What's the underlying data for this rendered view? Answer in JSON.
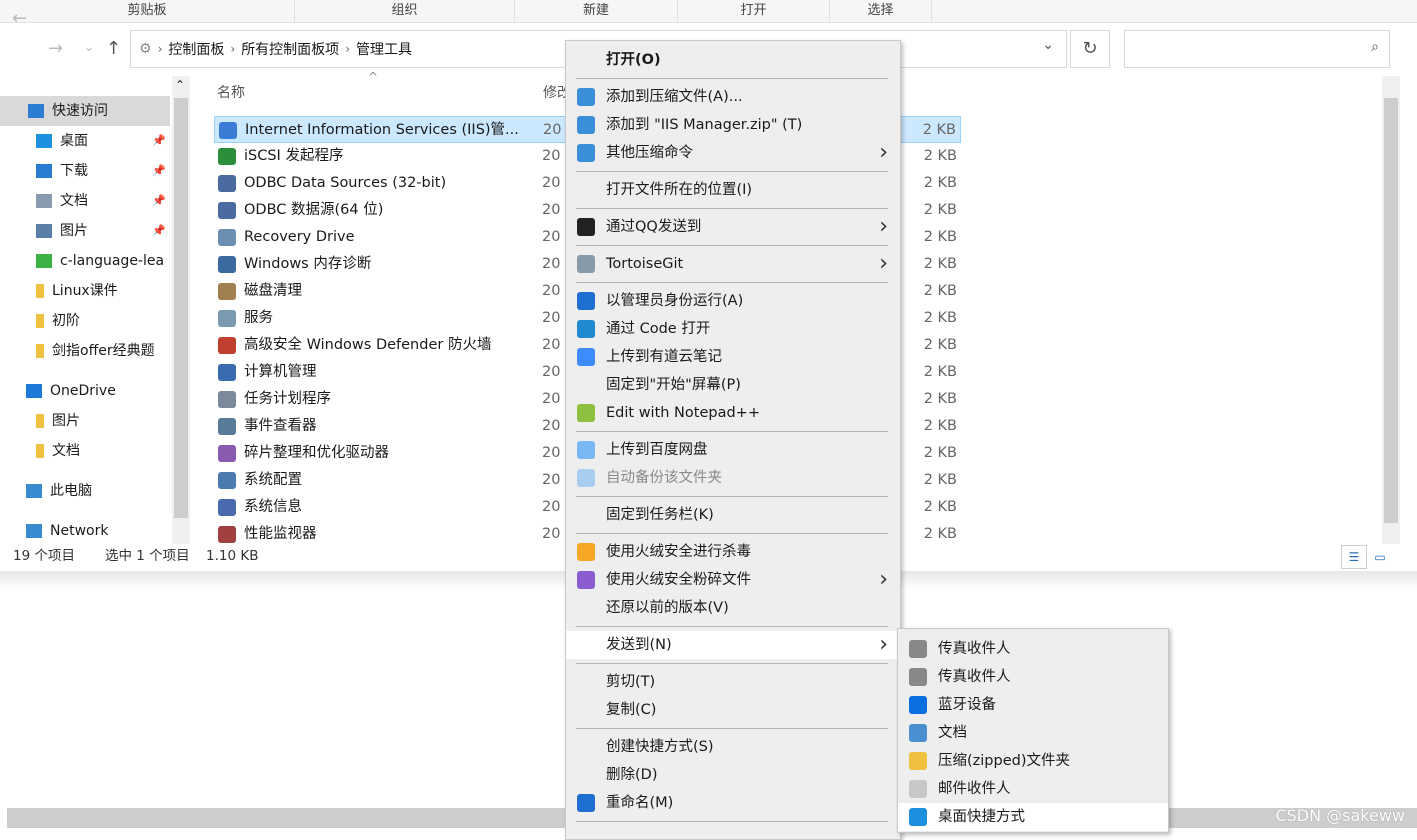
{
  "ribbon": {
    "groups": [
      "剪贴板",
      "组织",
      "新建",
      "打开",
      "选择"
    ]
  },
  "address": {
    "crumbs": [
      "控制面板",
      "所有控制面板项",
      "管理工具"
    ],
    "search_placeholder": ""
  },
  "sidebar": {
    "items": [
      {
        "label": "快速访问",
        "icon": "star-icon",
        "color": "#2b7cd3"
      },
      {
        "label": "桌面",
        "icon": "desktop-icon",
        "color": "#1e90e0",
        "pinned": true
      },
      {
        "label": "下载",
        "icon": "download-icon",
        "color": "#2b7cd3",
        "pinned": true
      },
      {
        "label": "文档",
        "icon": "document-icon",
        "color": "#8a9bb0",
        "pinned": true
      },
      {
        "label": "图片",
        "icon": "pictures-icon",
        "color": "#5a7fa6",
        "pinned": true
      },
      {
        "label": "c-language-lea",
        "icon": "folder-sync-icon",
        "color": "#3cb043"
      },
      {
        "label": "Linux课件",
        "icon": "folder-icon",
        "color": "#f0c040"
      },
      {
        "label": "初阶",
        "icon": "folder-icon",
        "color": "#f0c040"
      },
      {
        "label": "剑指offer经典题",
        "icon": "folder-icon",
        "color": "#f0c040"
      },
      {
        "label": "OneDrive",
        "icon": "cloud-icon",
        "color": "#1e78d7"
      },
      {
        "label": "图片",
        "icon": "folder-icon",
        "color": "#f0c040"
      },
      {
        "label": "文档",
        "icon": "folder-icon",
        "color": "#f0c040"
      },
      {
        "label": "此电脑",
        "icon": "computer-icon",
        "color": "#3a8ad0"
      },
      {
        "label": "Network",
        "icon": "network-icon",
        "color": "#3a8ad0"
      }
    ]
  },
  "list": {
    "columns": {
      "name": "名称",
      "modified": "修改"
    },
    "files": [
      {
        "name": "Internet Information Services (IIS)管...",
        "date": "20",
        "size": "2 KB",
        "selected": true
      },
      {
        "name": "iSCSI 发起程序",
        "date": "20",
        "size": "2 KB"
      },
      {
        "name": "ODBC Data Sources (32-bit)",
        "date": "20",
        "size": "2 KB"
      },
      {
        "name": "ODBC 数据源(64 位)",
        "date": "20",
        "size": "2 KB"
      },
      {
        "name": "Recovery Drive",
        "date": "20",
        "size": "2 KB"
      },
      {
        "name": "Windows 内存诊断",
        "date": "20",
        "size": "2 KB"
      },
      {
        "name": "磁盘清理",
        "date": "20",
        "size": "2 KB"
      },
      {
        "name": "服务",
        "date": "20",
        "size": "2 KB"
      },
      {
        "name": "高级安全 Windows Defender 防火墙",
        "date": "20",
        "size": "2 KB"
      },
      {
        "name": "计算机管理",
        "date": "20",
        "size": "2 KB"
      },
      {
        "name": "任务计划程序",
        "date": "20",
        "size": "2 KB"
      },
      {
        "name": "事件查看器",
        "date": "20",
        "size": "2 KB"
      },
      {
        "name": "碎片整理和优化驱动器",
        "date": "20",
        "size": "2 KB"
      },
      {
        "name": "系统配置",
        "date": "20",
        "size": "2 KB"
      },
      {
        "name": "系统信息",
        "date": "20",
        "size": "2 KB"
      },
      {
        "name": "性能监视器",
        "date": "20",
        "size": "2 KB"
      }
    ]
  },
  "status": {
    "count": "19 个项目",
    "selected": "选中 1 个项目",
    "size": "1.10 KB"
  },
  "context_menu": [
    {
      "label": "打开(O)",
      "bold": true
    },
    {
      "sep": true
    },
    {
      "label": "添加到压缩文件(A)...",
      "icon": "winrar-icon",
      "color": "#3b8ed8"
    },
    {
      "label": "添加到 \"IIS Manager.zip\" (T)",
      "icon": "winrar-icon",
      "color": "#3b8ed8"
    },
    {
      "label": "其他压缩命令",
      "icon": "winrar-icon",
      "color": "#3b8ed8",
      "submenu": true
    },
    {
      "sep": true
    },
    {
      "label": "打开文件所在的位置(I)"
    },
    {
      "sep": true
    },
    {
      "label": "通过QQ发送到",
      "icon": "qq-icon",
      "color": "#222",
      "submenu": true
    },
    {
      "sep": true
    },
    {
      "label": "TortoiseGit",
      "icon": "tortoisegit-icon",
      "color": "#8899aa",
      "submenu": true
    },
    {
      "sep": true
    },
    {
      "label": "以管理员身份运行(A)",
      "icon": "uac-shield-icon",
      "color": "#1e6fd0"
    },
    {
      "label": "通过 Code 打开",
      "icon": "vscode-icon",
      "color": "#1f8ad2"
    },
    {
      "label": "上传到有道云笔记",
      "icon": "youdao-note-icon",
      "color": "#3d8bfd"
    },
    {
      "label": "固定到\"开始\"屏幕(P)"
    },
    {
      "label": "Edit with Notepad++",
      "icon": "notepad-plus-icon",
      "color": "#8fbf3f"
    },
    {
      "sep": true
    },
    {
      "label": "上传到百度网盘",
      "icon": "baidu-netdisk-icon",
      "color": "#7ab8f5"
    },
    {
      "label": "自动备份该文件夹",
      "icon": "baidu-netdisk-icon",
      "color": "#a9cdf0",
      "disabled": true
    },
    {
      "sep": true
    },
    {
      "label": "固定到任务栏(K)"
    },
    {
      "sep": true
    },
    {
      "label": "使用火绒安全进行杀毒",
      "icon": "huorong-icon",
      "color": "#f5a623"
    },
    {
      "label": "使用火绒安全粉碎文件",
      "icon": "shredder-icon",
      "color": "#8a5cd0",
      "submenu": true
    },
    {
      "label": "还原以前的版本(V)"
    },
    {
      "sep": true
    },
    {
      "label": "发送到(N)",
      "submenu": true,
      "highlighted": true
    },
    {
      "sep": true
    },
    {
      "label": "剪切(T)"
    },
    {
      "label": "复制(C)"
    },
    {
      "sep": true
    },
    {
      "label": "创建快捷方式(S)"
    },
    {
      "label": "删除(D)"
    },
    {
      "label": "重命名(M)",
      "icon": "uac-shield-icon",
      "color": "#1e6fd0"
    },
    {
      "sep": true
    }
  ],
  "send_to_menu": [
    {
      "label": "传真收件人",
      "icon": "fax-icon",
      "color": "#888"
    },
    {
      "label": "传真收件人",
      "icon": "fax-icon",
      "color": "#888"
    },
    {
      "label": "蓝牙设备",
      "icon": "bluetooth-icon",
      "color": "#0a6fe0"
    },
    {
      "label": "文档",
      "icon": "document-icon",
      "color": "#4a90d0"
    },
    {
      "label": "压缩(zipped)文件夹",
      "icon": "zip-folder-icon",
      "color": "#f0c040"
    },
    {
      "label": "邮件收件人",
      "icon": "mail-icon",
      "color": "#c8c8c8"
    },
    {
      "label": "桌面快捷方式",
      "icon": "desktop-icon",
      "color": "#1e90e0",
      "highlighted": true
    }
  ],
  "watermark": "CSDN @sakeww"
}
